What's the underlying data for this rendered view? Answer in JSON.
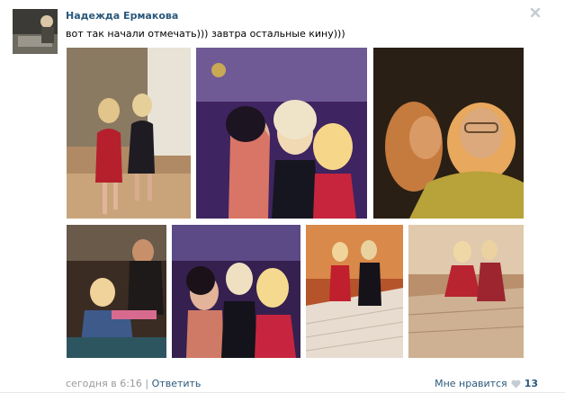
{
  "post": {
    "author": "Надежда Ермакова",
    "text": "вот так начали отмечать))) завтра остальные кину)))",
    "timestamp": "сегодня в 6:16",
    "separator": "|",
    "reply_label": "Ответить",
    "like_label": "Мне нравится",
    "like_count": "13"
  },
  "icons": {
    "close": "close-icon",
    "like": "heart-icon"
  },
  "colors": {
    "link": "#2b587a",
    "meta": "#999999",
    "heart": "#c4ccd4"
  }
}
